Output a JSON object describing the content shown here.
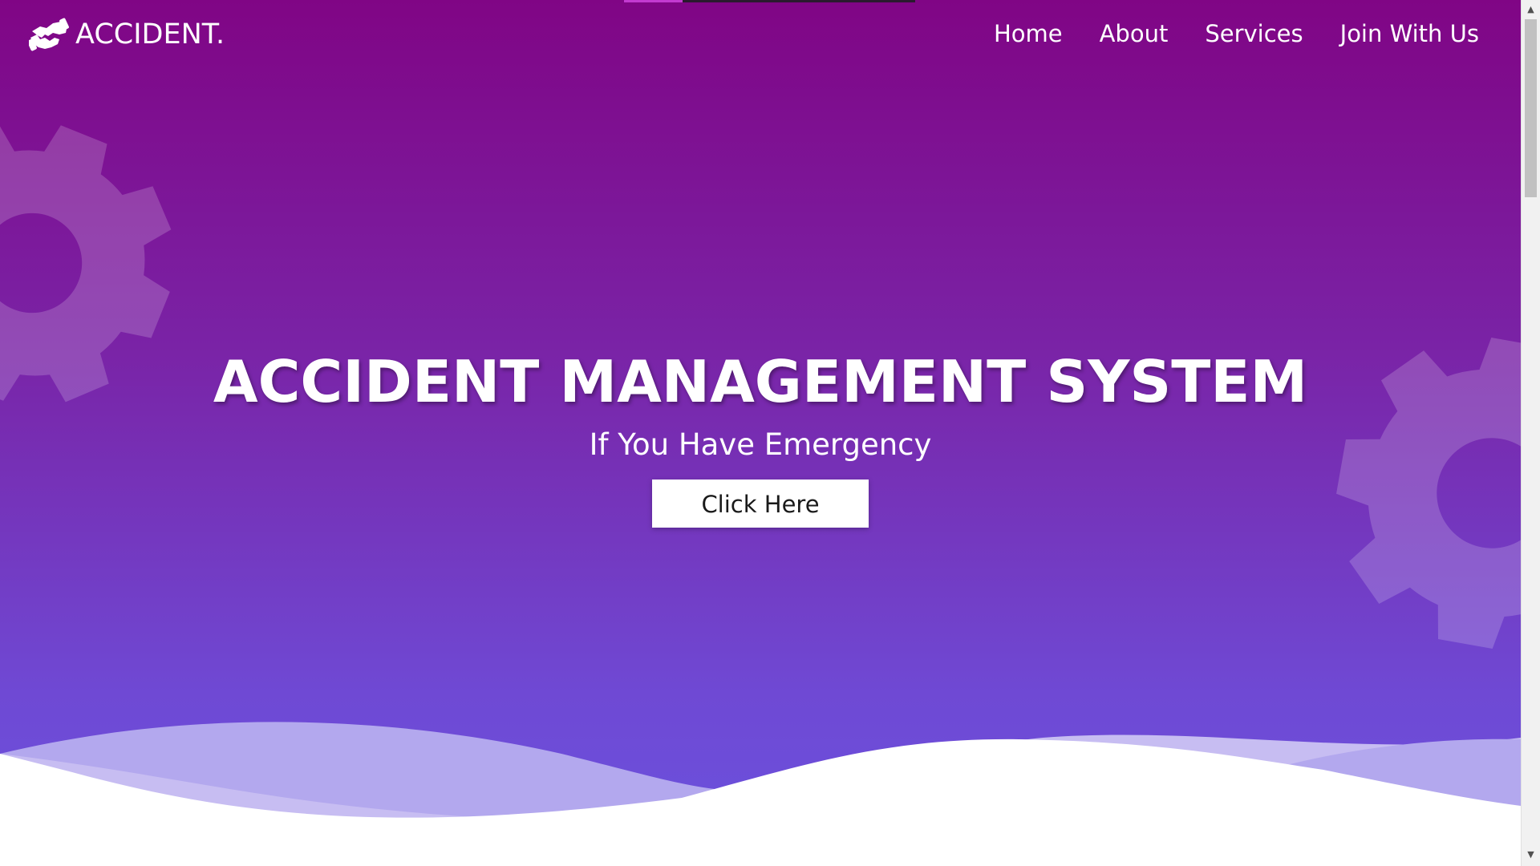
{
  "brand": {
    "name": "ACCIDENT.",
    "logo_icon": "handshake-icon"
  },
  "nav": {
    "items": [
      {
        "label": "Home"
      },
      {
        "label": "About"
      },
      {
        "label": "Services"
      },
      {
        "label": "Join With Us"
      }
    ]
  },
  "hero": {
    "title": "ACCIDENT MANAGEMENT SYSTEM",
    "subtitle": "If You Have Emergency",
    "button_label": "Click Here",
    "decorations": [
      "gear-icon",
      "gear-icon",
      "wave"
    ]
  },
  "colors": {
    "gradient_top": "#800585",
    "gradient_bottom": "#6a52de",
    "accent": "#c23ad0",
    "button_bg": "#ffffff",
    "wave_light": "#c7bdf2",
    "wave_mid": "#b1a3ee"
  },
  "scrollbar": {
    "up_icon": "chevron-up-icon",
    "down_icon": "chevron-down-icon"
  }
}
